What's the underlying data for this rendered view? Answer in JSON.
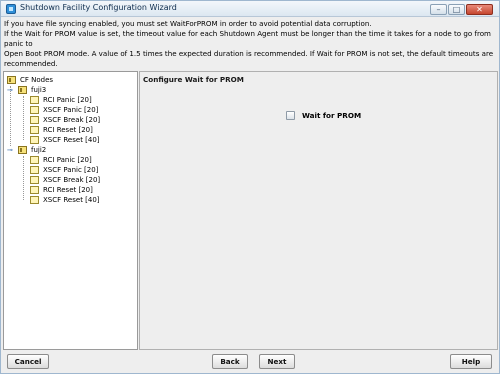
{
  "window": {
    "title": "Shutdown Facility Configuration Wizard",
    "controls": {
      "minimize": "–",
      "maximize": "□",
      "close": "✕"
    }
  },
  "info": {
    "line1": "If you have file syncing enabled, you must set WaitForPROM in order to avoid potential data corruption.",
    "line2": "If the Wait for PROM value is set, the timeout value for each Shutdown Agent must be longer than the time it takes for a node to go from panic to",
    "line3": "Open Boot PROM mode.  A value of 1.5 times the expected duration is recommended.  If Wait for PROM is not set, the default timeouts are",
    "line4": "recommended."
  },
  "tree": {
    "root": "CF Nodes",
    "nodes": [
      {
        "name": "fuji3",
        "agents": [
          "RCI Panic [20]",
          "XSCF Panic [20]",
          "XSCF Break [20]",
          "RCI Reset [20]",
          "XSCF Reset [40]"
        ]
      },
      {
        "name": "fuji2",
        "agents": [
          "RCI Panic [20]",
          "XSCF Panic [20]",
          "XSCF Break [20]",
          "RCI Reset [20]",
          "XSCF Reset [40]"
        ]
      }
    ]
  },
  "panel": {
    "title": "Configure Wait for PROM",
    "checkbox_label": "Wait for PROM"
  },
  "buttons": {
    "cancel": "Cancel",
    "back": "Back",
    "next": "Next",
    "help": "Help"
  }
}
